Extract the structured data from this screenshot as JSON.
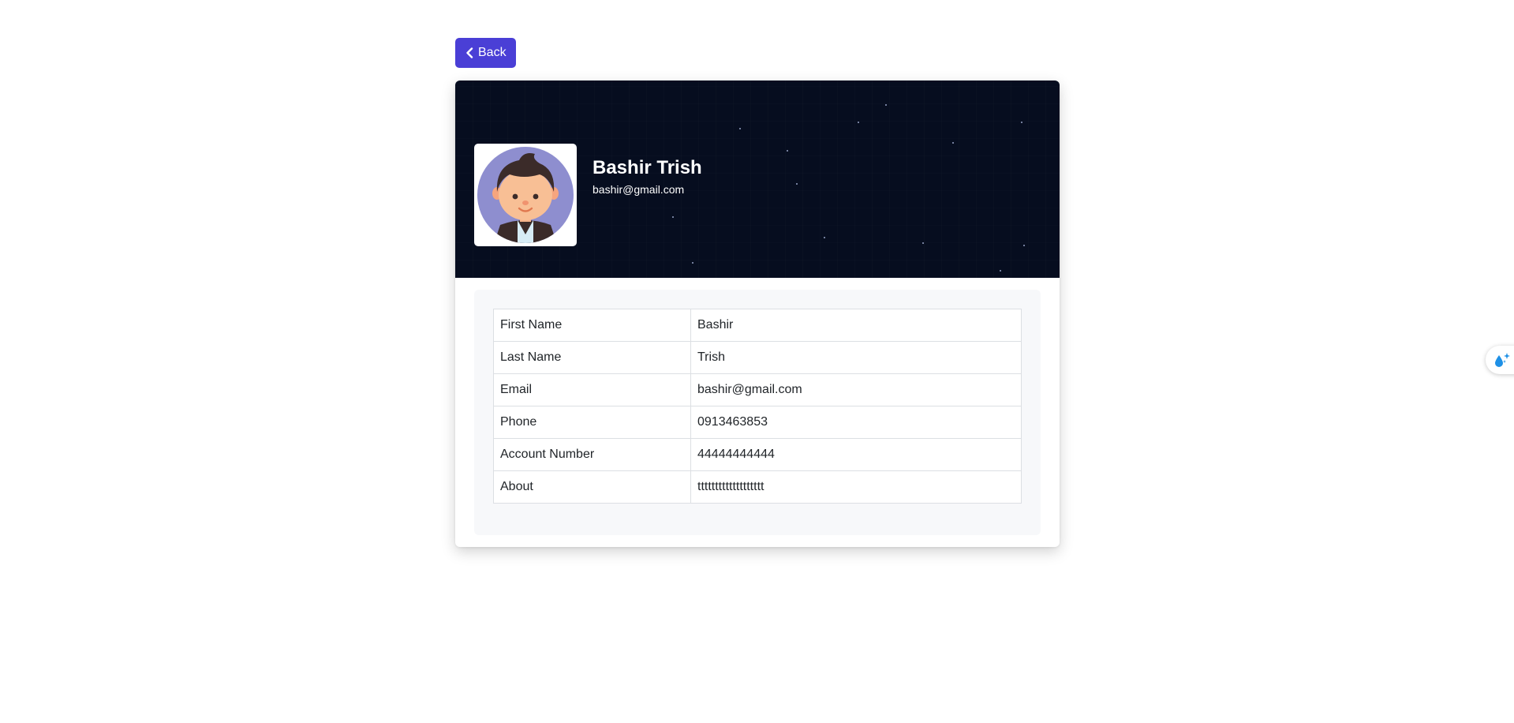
{
  "back_button": {
    "label": "Back",
    "icon": "chevron-left-icon"
  },
  "profile": {
    "name": "Bashir Trish",
    "email": "bashir@gmail.com",
    "avatar": "avatar-illustration"
  },
  "details": [
    {
      "label": "First Name",
      "value": "Bashir"
    },
    {
      "label": "Last Name",
      "value": "Trish"
    },
    {
      "label": "Email",
      "value": "bashir@gmail.com"
    },
    {
      "label": "Phone",
      "value": "0913463853"
    },
    {
      "label": "Account Number",
      "value": "44444444444"
    },
    {
      "label": "About",
      "value": "ttttttttttttttttttt"
    }
  ],
  "side_widget": {
    "icon": "water-drop-sparkle-icon"
  },
  "colors": {
    "accent": "#4a3fd6",
    "banner": "#060d1f",
    "avatar_bg": "#8e8ecf"
  }
}
